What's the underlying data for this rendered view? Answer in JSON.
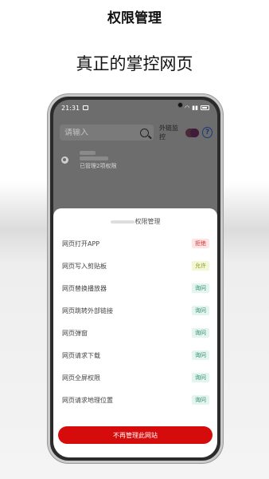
{
  "caption": {
    "title": "权限管理",
    "subtitle": "真正的掌控网页"
  },
  "status_bar": {
    "time": "21:31"
  },
  "toolbar": {
    "search_placeholder": "请输入",
    "monitor_label": "外链监控",
    "monitor_enabled": true,
    "help_label": "?"
  },
  "site": {
    "sub_label": "已管理2项权限"
  },
  "sheet": {
    "title_suffix": "权限管理",
    "permissions": [
      {
        "label": "网页打开APP",
        "status": "拒绝",
        "kind": "deny"
      },
      {
        "label": "网页写入剪贴板",
        "status": "允许",
        "kind": "allow"
      },
      {
        "label": "网页替换播放器",
        "status": "询问",
        "kind": "ask"
      },
      {
        "label": "网页跳转外部链接",
        "status": "询问",
        "kind": "ask"
      },
      {
        "label": "网页弹窗",
        "status": "询问",
        "kind": "ask"
      },
      {
        "label": "网页请求下载",
        "status": "询问",
        "kind": "ask"
      },
      {
        "label": "网页全屏权限",
        "status": "询问",
        "kind": "ask"
      },
      {
        "label": "网页请求地理位置",
        "status": "询问",
        "kind": "ask"
      }
    ],
    "footer_button": "不再管理此网站"
  },
  "colors": {
    "deny": "#d63535",
    "allow": "#8a9a1a",
    "ask": "#2e8a6a",
    "primary": "#d60b0b"
  }
}
